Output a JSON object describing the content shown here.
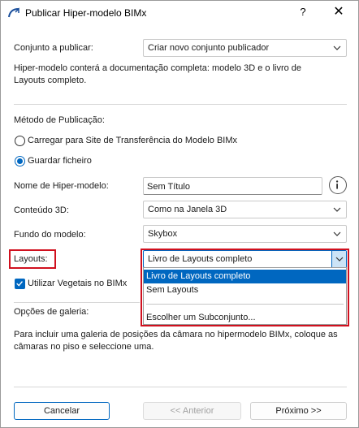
{
  "window": {
    "title": "Publicar Hiper-modelo BIMx",
    "help_label": "?",
    "close_label": "✕"
  },
  "publish_set": {
    "label": "Conjunto a publicar:",
    "value": "Criar novo conjunto publicador",
    "description": "Hiper-modelo conterá a documentação completa: modelo 3D e o livro de Layouts completo."
  },
  "method": {
    "heading": "Método de Publicação:",
    "options": [
      {
        "label": "Carregar para Site de Transferência do Modelo BIMx",
        "selected": false
      },
      {
        "label": "Guardar ficheiro",
        "selected": true
      }
    ]
  },
  "fields": {
    "name_label": "Nome de Hiper-modelo:",
    "name_value": "Sem Título",
    "content3d_label": "Conteúdo 3D:",
    "content3d_value": "Como na Janela 3D",
    "background_label": "Fundo do modelo:",
    "background_value": "Skybox",
    "layouts_label": "Layouts:",
    "layouts_value": "Livro de Layouts completo"
  },
  "layouts_dropdown": {
    "options": [
      {
        "label": "Livro de Layouts completo",
        "selected": true
      },
      {
        "label": "Sem Layouts",
        "selected": false
      },
      {
        "label": "Escolher um Subconjunto...",
        "selected": false
      }
    ]
  },
  "vegetation": {
    "label": "Utilizar Vegetais no BIMx",
    "checked": true
  },
  "gallery": {
    "label": "Opções de galeria:",
    "description": "Para incluir uma galeria de posições da câmara no hipermodelo BIMx, coloque as câmaras no piso e seleccione uma."
  },
  "footer": {
    "cancel_label": "Cancelar",
    "previous_label": "<< Anterior",
    "next_label": "Próximo >>"
  },
  "colors": {
    "accent": "#0067c0",
    "highlight_border": "#d0101e"
  }
}
